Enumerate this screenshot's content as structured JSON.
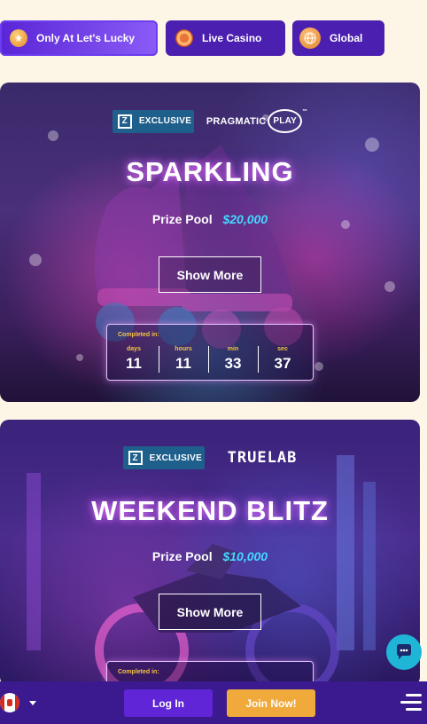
{
  "filters": [
    {
      "label": "Only At Let's Lucky",
      "icon": "lucky-coin-icon",
      "active": true
    },
    {
      "label": "Live Casino",
      "icon": "casino-chip-icon",
      "active": false
    },
    {
      "label": "Global",
      "icon": "globe-icon",
      "active": false
    }
  ],
  "tournaments": [
    {
      "badge": "EXCLUSIVE",
      "provider": "PRAGMATIC PLAY",
      "provider_parts": [
        "PRAGMATIC",
        "PLAY"
      ],
      "tm": "™",
      "title": "SPARKLING",
      "prize_label": "Prize Pool",
      "prize_amount": "$20,000",
      "button": "Show More",
      "completed_label": "Completed in:",
      "units": [
        "days",
        "hours",
        "min",
        "sec"
      ],
      "values": [
        "11",
        "11",
        "33",
        "37"
      ]
    },
    {
      "badge": "EXCLUSIVE",
      "provider": "TRUELAB",
      "title": "WEEKEND BLITZ",
      "prize_label": "Prize Pool",
      "prize_amount": "$10,000",
      "button": "Show More",
      "completed_label": "Completed in:"
    }
  ],
  "bottom_bar": {
    "country_flag": "canada-flag",
    "login": "Log In",
    "join": "Join Now!"
  },
  "colors": {
    "page_bg": "#fdf5e6",
    "tab_bg": "#4b1fb0",
    "prize_accent": "#44d7ff",
    "timer_accent": "#f5c542",
    "login_bg": "#5f25d6",
    "join_bg": "#f0a93b",
    "chat_bg": "#1fb5d6"
  }
}
